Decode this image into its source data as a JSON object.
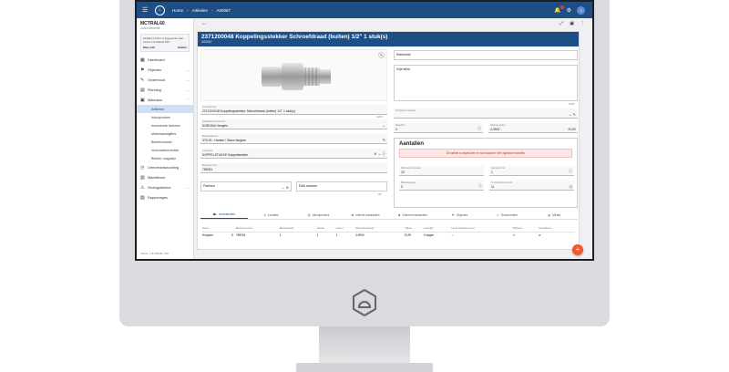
{
  "topbar": {
    "crumbs": [
      "Home",
      "Artikelen",
      "A00067"
    ],
    "avatar_initial": "J"
  },
  "sidebar": {
    "org": "MCTRAL60",
    "user": "John Doorelle",
    "status_text": "McMain Online is bijgewerkt naar versie 1.8.9 Build 159",
    "status_more": "Meer info",
    "status_close": "Sluiten",
    "items": [
      {
        "label": "Dashboard",
        "icon": "dashboard-icon",
        "glyph": "▦"
      },
      {
        "label": "Objecten",
        "icon": "objects-icon",
        "glyph": "⚑",
        "chev": "⌄"
      },
      {
        "label": "Onderhoud",
        "icon": "wrench-icon",
        "glyph": "✎",
        "chev": "⌄"
      },
      {
        "label": "Planning",
        "icon": "calendar-icon",
        "glyph": "▤",
        "chev": "⌄"
      },
      {
        "label": "Materiaal",
        "icon": "box-icon",
        "glyph": "▣",
        "chev": "⌃"
      }
    ],
    "subitems": [
      "Artikelen",
      "Inkooporders",
      "Inkomende facturen",
      "Materiaaluitgiftes",
      "Bestelvoorstel",
      "Voorraadcorrecties",
      "Beheer magazijn"
    ],
    "items2": [
      {
        "label": "Urenverantwoording",
        "icon": "clock-icon",
        "glyph": "◷"
      },
      {
        "label": "Machtiboek",
        "icon": "book-icon",
        "glyph": "▥"
      },
      {
        "label": "Storingsbeheer",
        "icon": "warning-icon",
        "glyph": "⚠",
        "chev": "⌄"
      },
      {
        "label": "Rapportages",
        "icon": "report-icon",
        "glyph": "▧"
      }
    ],
    "version": "Versie: 1.8.9 Build: 159"
  },
  "article": {
    "title": "2371200048 Koppelingsstekker Schroefdraad (buiten) 1/2\" 1 stuk(s)",
    "code": "A00067",
    "fields": {
      "omschrijving_label": "Omschrijving",
      "omschrijving_value": "2371200048 Koppelingsstekker Schroefdraad (buiten) 1/2\" 1 stuk(s)",
      "leverancier_label": "Standaard leverancier",
      "leverancier_value": "KORONA Hengelo",
      "counter": "44/50",
      "groep_label": "Materiaalgroep",
      "groep_value": "375.00 - Harsen / Slazo fangtan",
      "categorie_label": "Categorie",
      "categorie_value": "KOPPELSTUKKE Koppelstukken",
      "artikel_label": "Bestelnummer",
      "artikel_value": "785051",
      "pakket_label": "Pakbord",
      "ean_label": "EAN nummer",
      "ean_counter": "0/8",
      "referentie_label": "Referentie",
      "memo_label": "Vrije tekst",
      "memo_counter": "0/400",
      "voorkeur_label": "Voorkeursmagazijn",
      "aantal_label": "Bestellen",
      "aantal_value": "0",
      "prijs_label": "Waarde artikel",
      "prijs_value": "4,9900",
      "prijs_unit": "EUR"
    }
  },
  "aantallen": {
    "title": "Aantallen",
    "alert": "Dit artikel is afgesloten en kan daarom niet ingekocht worden",
    "f1_label": "Minimale voorraad",
    "f1_value": "10",
    "f2_label": "Aanvullen tot",
    "f2_value": "1",
    "f3_label": "Bestelwaarde",
    "f3_value": "0",
    "f4_label": "In productieverbruik",
    "f4_value": "11"
  },
  "tabs": [
    {
      "label": "Leveranciers",
      "icon": "truck-icon",
      "glyph": "⛟"
    },
    {
      "label": "Locaties",
      "icon": "pin-icon",
      "glyph": "⚲"
    },
    {
      "label": "Inkooporders",
      "icon": "cart-icon",
      "glyph": "⛒"
    },
    {
      "label": "Interne transacties",
      "icon": "transaction-icon",
      "glyph": "⇄"
    },
    {
      "label": "Externe transacties",
      "icon": "external-icon",
      "glyph": "⇆"
    },
    {
      "label": "Objecten",
      "icon": "objects-tab-icon",
      "glyph": "⚑"
    },
    {
      "label": "Documenten",
      "icon": "document-icon",
      "glyph": "▭"
    },
    {
      "label": "Media",
      "icon": "media-icon",
      "glyph": "▨"
    }
  ],
  "table": {
    "headers": [
      "Naam",
      "",
      "Bestelnummer",
      "Bestelwaard",
      "Aantal",
      "Factor",
      "Netto Bestelprijs",
      "Valuta",
      "Levertijd",
      "Heeft Artikelnummer",
      "Wijzigen",
      "Verwijderen"
    ],
    "row": [
      "Horgsen",
      "€",
      "785051",
      "1",
      "1",
      "1",
      "4,9900",
      "EUR",
      "0 dagen",
      "○",
      "✎",
      "⊘"
    ]
  },
  "colors": {
    "primary": "#1d4f86",
    "accent": "#f05a28"
  }
}
